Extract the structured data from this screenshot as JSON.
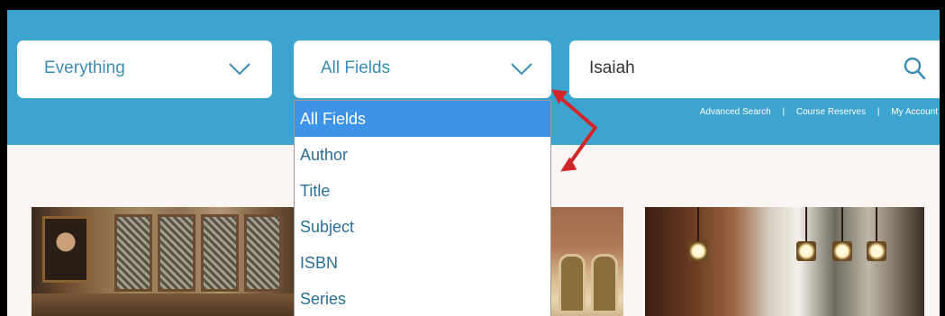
{
  "colors": {
    "header": "#3da3cf",
    "accent": "#3c8db4",
    "selected": "#3d94e6",
    "arrow": "#d0282a"
  },
  "search": {
    "scope_value": "Everything",
    "field_value": "All Fields",
    "query_value": "Isaiah"
  },
  "links": [
    "Advanced Search",
    "Course Reserves",
    "My Account"
  ],
  "link_separator": "|",
  "field_options": [
    "All Fields",
    "Author",
    "Title",
    "Subject",
    "ISBN",
    "Series"
  ],
  "selected_option": "All Fields",
  "icons": {
    "scope_toggle": "chevron-down-icon",
    "field_toggle": "chevron-down-icon",
    "search": "search-icon"
  }
}
